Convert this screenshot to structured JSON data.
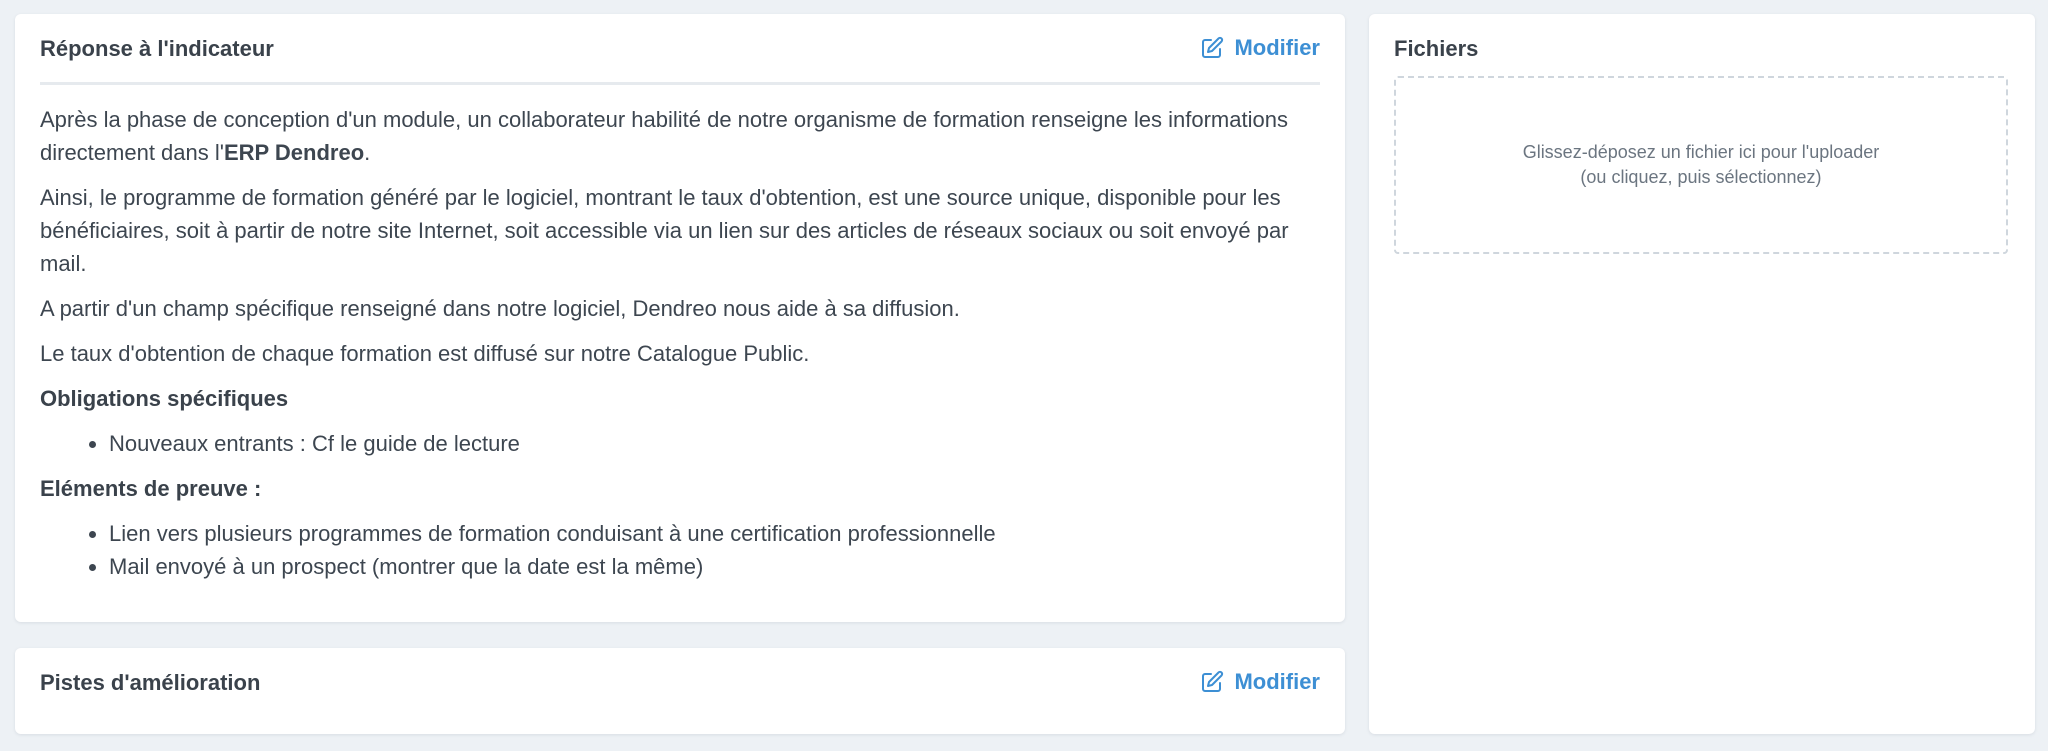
{
  "response_card": {
    "title": "Réponse à l'indicateur",
    "edit_label": "Modifier",
    "paragraph1_before": "Après la phase de conception d'un module, un collaborateur habilité de notre organisme de formation renseigne les informations directement dans l'",
    "paragraph1_bold": "ERP Dendreo",
    "paragraph1_after": ".",
    "paragraph2": "Ainsi, le programme de formation généré par le logiciel, montrant le taux d'obtention, est une source unique, disponible pour les bénéficiaires, soit à partir de notre site Internet, soit accessible via un lien sur des articles de réseaux sociaux ou soit envoyé par mail.",
    "paragraph3": "A partir d'un champ spécifique renseigné dans notre logiciel, Dendreo nous aide à sa diffusion.",
    "paragraph4": "Le taux d'obtention de chaque formation est diffusé sur notre Catalogue Public.",
    "obligations_heading": "Obligations spécifiques",
    "obligations_items": [
      "Nouveaux entrants : Cf le guide de lecture"
    ],
    "preuve_heading": "Eléments de preuve :",
    "preuve_items": [
      "Lien vers plusieurs programmes de formation conduisant à une certification professionnelle",
      "Mail envoyé à un prospect (montrer que la date est la même)"
    ]
  },
  "pistes_card": {
    "title": "Pistes d'amélioration",
    "edit_label": "Modifier"
  },
  "files_card": {
    "title": "Fichiers",
    "dropzone_line1": "Glissez-déposez un fichier ici pour l'uploader",
    "dropzone_line2": "(ou cliquez, puis sélectionnez)"
  },
  "icons": {
    "edit": "edit-icon"
  },
  "colors": {
    "background": "#edf1f5",
    "accent": "#3d8fd4",
    "text": "#3d4650"
  }
}
